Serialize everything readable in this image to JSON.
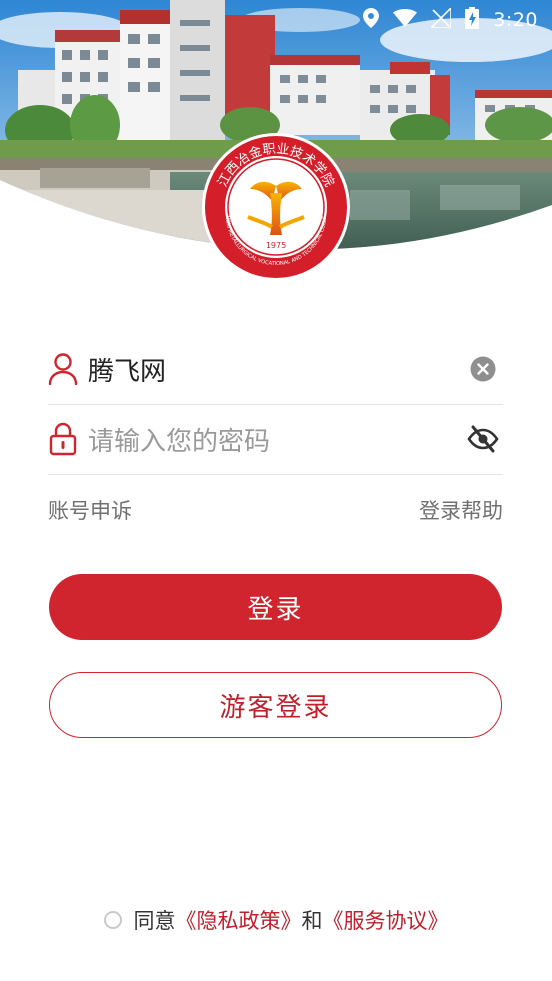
{
  "status_bar": {
    "time": "3:20"
  },
  "logo": {
    "year": "1975",
    "motto": "JIANGXI METALLURGICAL VOCATIONAL AND TECHNICAL COLLEGE",
    "arc_text": "江西冶金职业技术学院"
  },
  "account": {
    "value": "腾飞网"
  },
  "password": {
    "placeholder": "请输入您的密码"
  },
  "links": {
    "appeal": "账号申诉",
    "help": "登录帮助"
  },
  "buttons": {
    "login": "登录",
    "guest": "游客登录"
  },
  "agreement": {
    "agree": "同意",
    "privacy": "《隐私政策》",
    "and": "和",
    "service": "《服务协议》"
  },
  "colors": {
    "accent": "#d0242e",
    "text": "#222222",
    "muted": "#707070"
  }
}
